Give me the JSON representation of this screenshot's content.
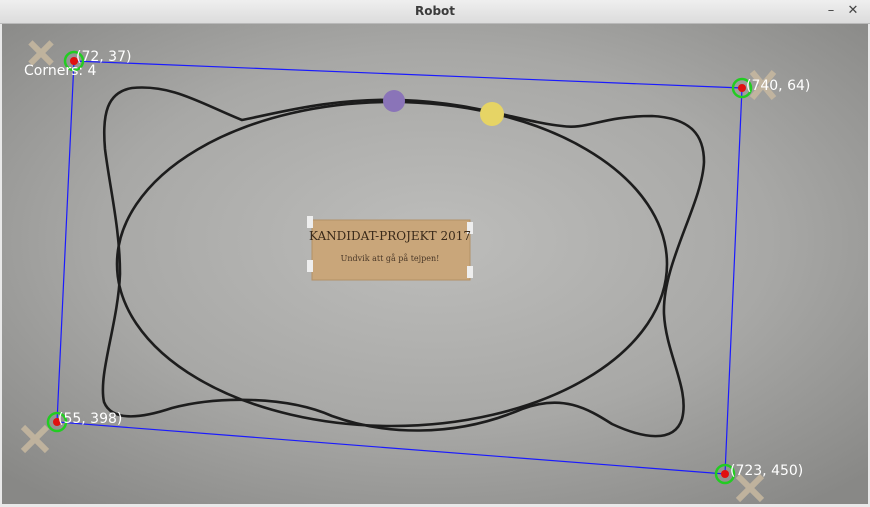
{
  "window": {
    "title": "Robot",
    "minimize_glyph": "–",
    "close_glyph": "✕"
  },
  "overlay": {
    "corners_label": "Corners: 4",
    "corner_labels": [
      "(72, 37)",
      "(740, 64)",
      "(55, 398)",
      "(723, 450)"
    ],
    "line_color": "#1a1aff",
    "marker_ring_color": "#22cc22",
    "marker_dot_color": "#e01010"
  },
  "scene": {
    "sign_line1": "KANDIDAT-PROJEKT 2017",
    "sign_line2": "Undvik att gå på tejpen!",
    "purple_marker_color": "#8a74b8",
    "yellow_marker_color": "#e6d465",
    "track_color": "#1d1d1d"
  }
}
